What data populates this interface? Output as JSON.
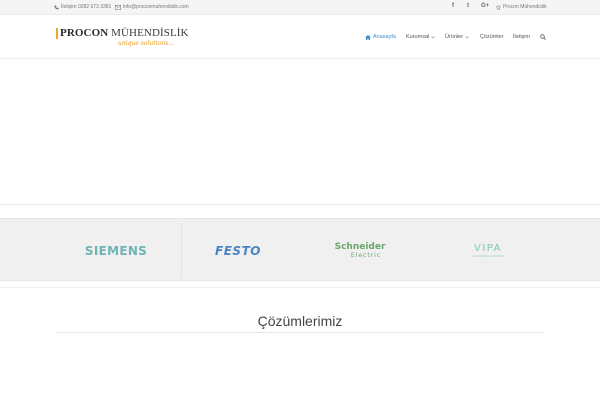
{
  "topbar": {
    "phone": "İletişim 0282 673 3381",
    "email": "info@proconmuhendislik.com",
    "social": [
      {
        "icon": "facebook-icon",
        "glyph": "f"
      },
      {
        "icon": "twitter-icon",
        "glyph": "t"
      },
      {
        "icon": "google-plus-icon",
        "glyph": "G+"
      }
    ],
    "brand_link": "Procon Mühendislik"
  },
  "logo": {
    "word_bold": "PROCON",
    "word_rest": " MÜHENDİSLİK",
    "tagline": "unique solutions..."
  },
  "nav": {
    "items": [
      {
        "label": "Anasayfa",
        "active": true,
        "dropdown": false
      },
      {
        "label": "Kurumsal",
        "active": false,
        "dropdown": true
      },
      {
        "label": "Ürünler",
        "active": false,
        "dropdown": true
      },
      {
        "label": "Çözümler",
        "active": false,
        "dropdown": false
      },
      {
        "label": "İletişim",
        "active": false,
        "dropdown": false
      }
    ]
  },
  "brands": {
    "siemens": "SIEMENS",
    "festo": "FESTO",
    "schneider_top": "Schneider",
    "schneider_bottom": "Electric",
    "vipa": "VIPA",
    "vipa_sub": "A YASKAWA COMPANY"
  },
  "section": {
    "title": "Çözümlerimiz"
  },
  "colors": {
    "accent": "#3b8ed1",
    "logo_orange": "#f0a62a",
    "topbar_bg": "#f5f5f5",
    "brands_bg": "#f0f0f0"
  }
}
